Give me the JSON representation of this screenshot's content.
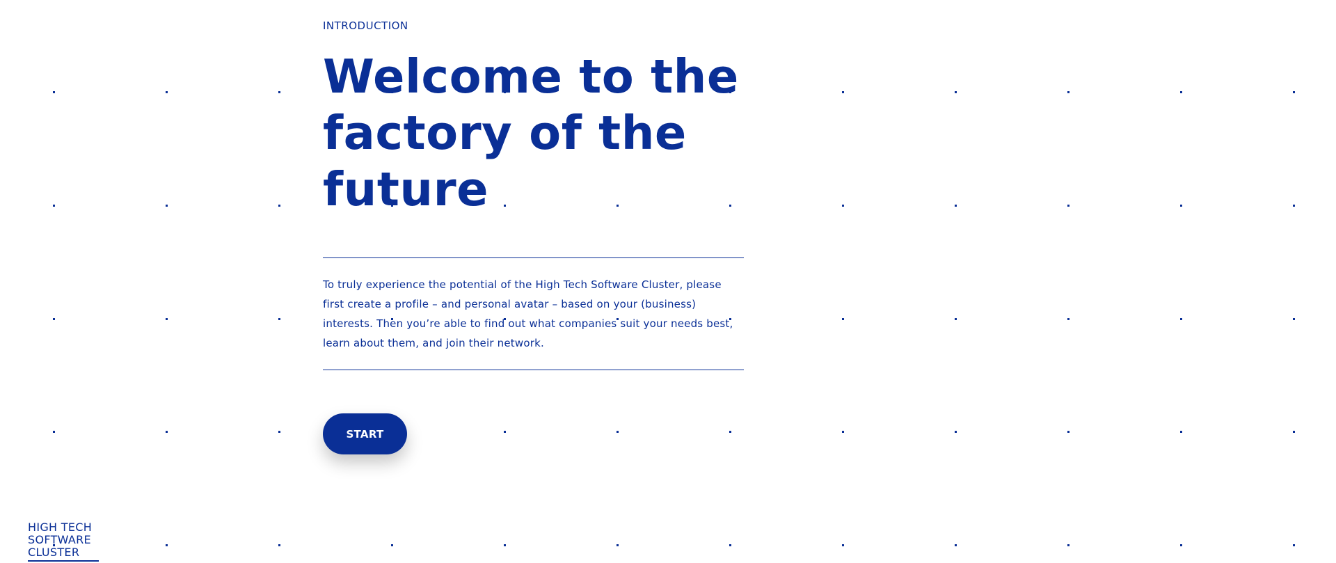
{
  "theme": {
    "primary": "#0a2f96",
    "background": "#ffffff",
    "button_text": "#ffffff"
  },
  "intro": {
    "eyebrow": "INTRODUCTION",
    "headline_lines": [
      "Welcome to the",
      "factory of the",
      "future"
    ],
    "body": "To truly experience the potential of the High Tech Software Cluster, please first create a profile – and personal avatar – based on your (business) interests. Then you’re able to find out what companies suit your needs best, learn about them, and join their network."
  },
  "actions": {
    "start_label": "START"
  },
  "logo": {
    "lines": [
      "HIGH TECH",
      "SOFTWARE",
      "CLUSTER"
    ]
  }
}
